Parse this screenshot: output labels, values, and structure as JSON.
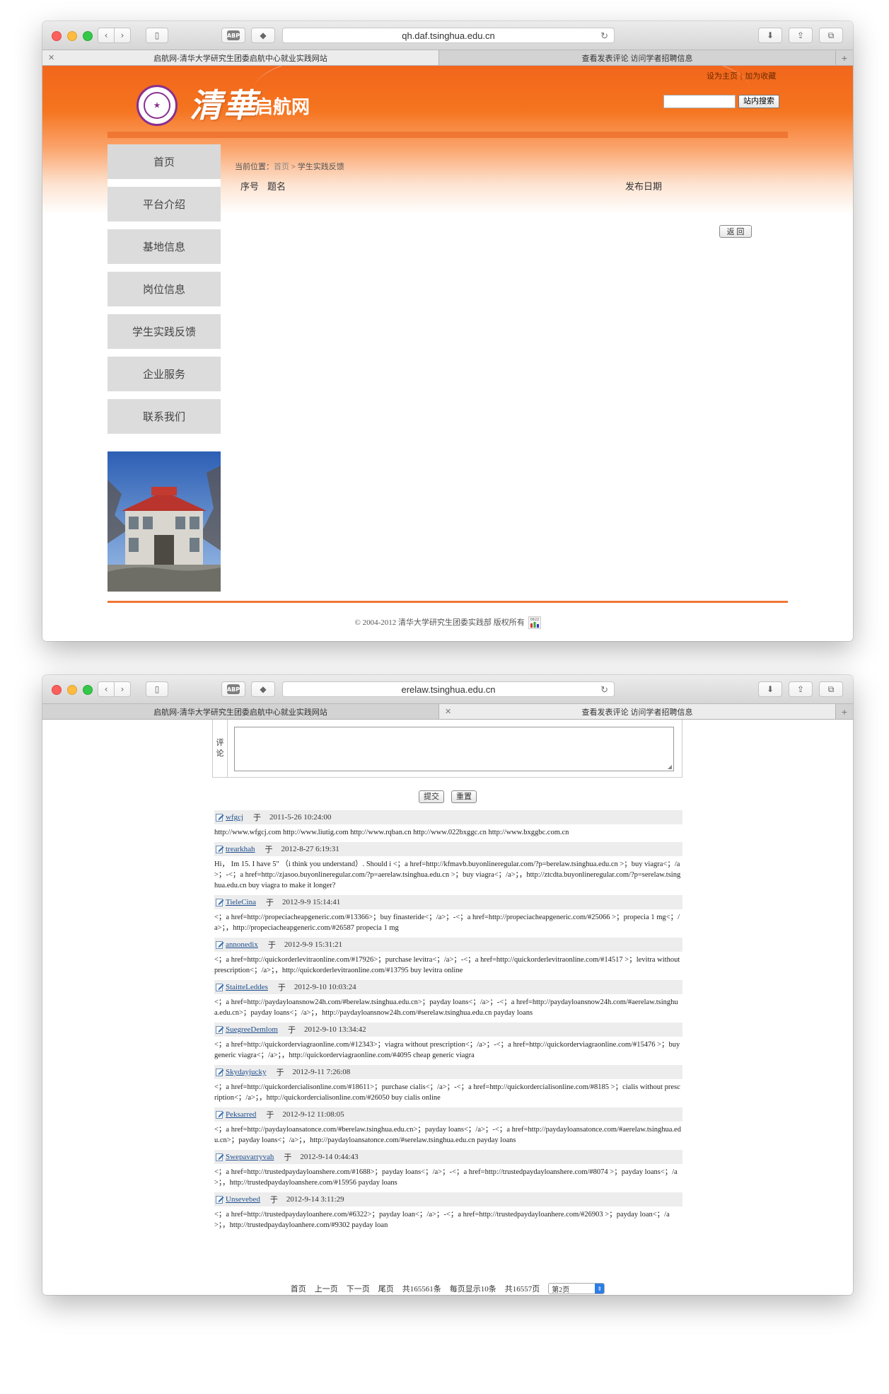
{
  "window1": {
    "url": "qh.daf.tsinghua.edu.cn",
    "tabs": [
      {
        "label": "启航网-清华大学研究生团委启航中心就业实践网站",
        "active": true
      },
      {
        "label": "查看发表评论 访问学者招聘信息",
        "active": false
      }
    ],
    "site": {
      "logo_title": "清華",
      "logo_subtitle": "启航网",
      "top_links": [
        "设为主页",
        "加为收藏"
      ],
      "search_button": "站内搜索",
      "search_value": "",
      "nav": [
        "首页",
        "平台介绍",
        "基地信息",
        "岗位信息",
        "学生实践反馈",
        "企业服务",
        "联系我们"
      ],
      "breadcrumb_prefix": "当前位置：",
      "breadcrumb_home": "首页",
      "breadcrumb_sep": " > ",
      "breadcrumb_current": "学生实践反馈",
      "col_index": "序号",
      "col_title": "题名",
      "col_date": "发布日期",
      "back_button": "返 回",
      "copyright": "© 2004-2012 清华大学研究生团委实践部 版权所有",
      "counter_text": "0622"
    }
  },
  "window2": {
    "url": "erelaw.tsinghua.edu.cn",
    "tabs": [
      {
        "label": "启航网-清华大学研究生团委启航中心就业实践网站",
        "active": false
      },
      {
        "label": "查看发表评论 访问学者招聘信息",
        "active": true
      }
    ],
    "form": {
      "label_1": "评",
      "label_2": "论",
      "submit": "提交",
      "reset": "重置"
    },
    "yu": "于",
    "comments": [
      {
        "author": "wfgcj",
        "date": "2011-5-26 10:24:00",
        "body": "http://www.wfgcj.com http://www.liutig.com http://www.rqban.cn http://www.022bxggc.cn http://www.bxggbc.com.cn"
      },
      {
        "author": "trearkhah",
        "date": "2012-8-27 6:19:31",
        "body": "Hi， Im 15. I have 5\" （i think you understand）. Should i <；a href=http://kfmavb.buyonlineregular.com/?p=berelaw.tsinghua.edu.cn >；buy viagra<；/a>；-<；a href=http://zjasoo.buyonlineregular.com/?p=aerelaw.tsinghua.edu.cn >；buy viagra<；/a>；，http://ztcdta.buyonlineregular.com/?p=serelaw.tsinghua.edu.cn buy viagra to make it longer?"
      },
      {
        "author": "TieleCina",
        "date": "2012-9-9 15:14:41",
        "body": "<；a href=http://propeciacheapgeneric.com/#13366>；buy finasteride<；/a>；-<；a href=http://propeciacheapgeneric.com/#25066 >；propecia 1 mg<；/a>；，http://propeciacheapgeneric.com/#26587 propecia 1 mg"
      },
      {
        "author": "annonedix",
        "date": "2012-9-9 15:31:21",
        "body": "<；a href=http://quickorderlevitraonline.com/#17926>；purchase levitra<；/a>；-<；a href=http://quickorderlevitraonline.com/#14517 >；levitra without prescription<；/a>；，http://quickorderlevitraonline.com/#13795 buy levitra online"
      },
      {
        "author": "StaitteLeddes",
        "date": "2012-9-10 10:03:24",
        "body": "<；a href=http://paydayloansnow24h.com/#berelaw.tsinghua.edu.cn>；payday loans<；/a>；-<；a href=http://paydayloansnow24h.com/#aerelaw.tsinghua.edu.cn>；payday loans<；/a>；，http://paydayloansnow24h.com/#serelaw.tsinghua.edu.cn payday loans"
      },
      {
        "author": "SuegreeDemlom",
        "date": "2012-9-10 13:34:42",
        "body": "<；a href=http://quickorderviagraonline.com/#12343>；viagra without prescription<；/a>；-<；a href=http://quickorderviagraonline.com/#15476 >；buy generic viagra<；/a>；，http://quickorderviagraonline.com/#4095 cheap generic viagra"
      },
      {
        "author": "Skydayjucky",
        "date": "2012-9-11 7:26:08",
        "body": "<；a href=http://quickordercialisonline.com/#18611>；purchase cialis<；/a>；-<；a href=http://quickordercialisonline.com/#8185 >；cialis without prescription<；/a>；，http://quickordercialisonline.com/#26050 buy cialis online"
      },
      {
        "author": "Peksarred",
        "date": "2012-9-12 11:08:05",
        "body": "<；a href=http://paydayloansatonce.com/#berelaw.tsinghua.edu.cn>；payday loans<；/a>；-<；a href=http://paydayloansatonce.com/#aerelaw.tsinghua.edu.cn>；payday loans<；/a>；，http://paydayloansatonce.com/#serelaw.tsinghua.edu.cn payday loans"
      },
      {
        "author": "Swepavarryvah",
        "date": "2012-9-14 0:44:43",
        "body": "<；a href=http://trustedpaydayloanshere.com/#1688>；payday loans<；/a>；-<；a href=http://trustedpaydayloanshere.com/#8074 >；payday loans<；/a>；，http://trustedpaydayloanshere.com/#15956 payday loans"
      },
      {
        "author": "Unsevebed",
        "date": "2012-9-14 3:11:29",
        "body": "<；a href=http://trustedpaydayloanhere.com/#6322>；payday loan<；/a>；-<；a href=http://trustedpaydayloanhere.com/#26903 >；payday loan<；/a>；，http://trustedpaydayloanhere.com/#9302 payday loan"
      }
    ],
    "pager": {
      "first": "首页",
      "prev": "上一页",
      "next": "下一页",
      "last": "尾页",
      "total_items": "共165561条",
      "per_page": "每页显示10条",
      "total_pages": "共16557页",
      "current": "第2页"
    }
  },
  "colors": {
    "brand_orange": "#f07634",
    "link_blue": "#1f4f8e",
    "tsinghua_purple": "#8a2f8e"
  }
}
